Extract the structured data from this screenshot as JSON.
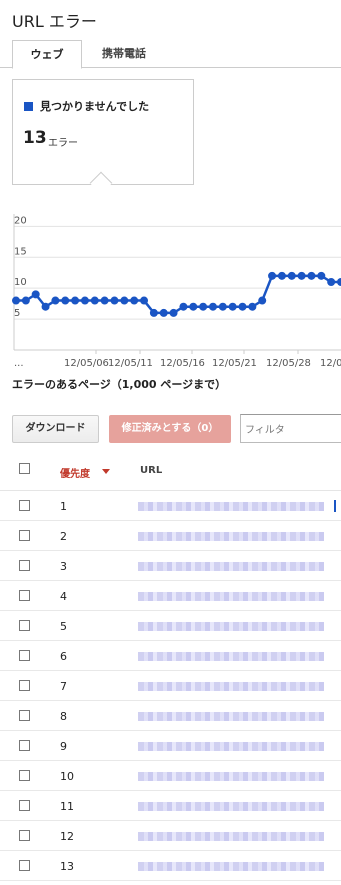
{
  "page": {
    "title": "URL エラー"
  },
  "tabs": [
    {
      "label": "ウェブ",
      "active": true
    },
    {
      "label": "携帯電話",
      "active": false
    }
  ],
  "summary": {
    "label": "見つかりませんでした",
    "count": "13",
    "unit": "エラー",
    "swatch_color": "#1a55c4"
  },
  "chart_data": {
    "type": "line",
    "y_ticks": [
      "20",
      "15",
      "10",
      "5"
    ],
    "ylim": [
      0,
      22
    ],
    "x_ticks": [
      "...",
      "12/05/06",
      "12/05/11",
      "12/05/16",
      "12/05/21",
      "12/05/28",
      "12/0"
    ],
    "series": [
      {
        "color": "#1a55c4",
        "values": [
          8,
          8,
          9,
          7,
          8,
          8,
          8,
          8,
          8,
          8,
          8,
          8,
          8,
          8,
          6,
          6,
          6,
          7,
          7,
          7,
          7,
          7,
          7,
          7,
          7,
          8,
          12,
          12,
          12,
          12,
          12,
          12,
          11,
          11
        ]
      }
    ]
  },
  "section": {
    "title": "エラーのあるページ（1,000 ページまで）"
  },
  "toolbar": {
    "download_label": "ダウンロード",
    "fix_label": "修正済みとする（0）",
    "filter_placeholder": "フィルタ"
  },
  "table": {
    "headers": {
      "priority": "優先度",
      "url": "URL"
    },
    "rows": [
      {
        "num": "1"
      },
      {
        "num": "2"
      },
      {
        "num": "3"
      },
      {
        "num": "4"
      },
      {
        "num": "5"
      },
      {
        "num": "6"
      },
      {
        "num": "7"
      },
      {
        "num": "8"
      },
      {
        "num": "9"
      },
      {
        "num": "10"
      },
      {
        "num": "11"
      },
      {
        "num": "12"
      },
      {
        "num": "13"
      }
    ]
  }
}
